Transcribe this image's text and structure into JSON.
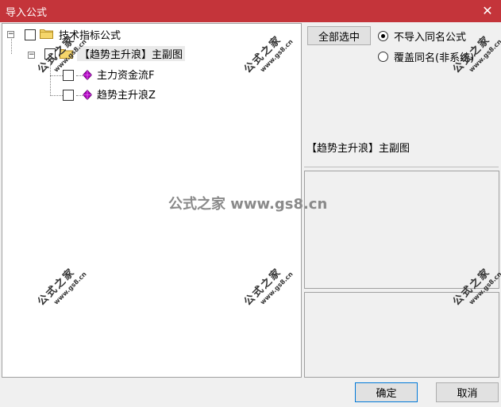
{
  "window": {
    "title": "导入公式",
    "close_glyph": "✕"
  },
  "tree": {
    "root": {
      "label": "技术指标公式",
      "expander": "−"
    },
    "group": {
      "label": "【趋势主升浪】主副图",
      "expander": "−"
    },
    "items": [
      {
        "label": "主力资金流F"
      },
      {
        "label": "趋势主升浪Z"
      }
    ]
  },
  "actions": {
    "select_all": "全部选中",
    "ok": "确定",
    "cancel": "取消"
  },
  "options": {
    "no_import_same": "不导入同名公式",
    "overwrite_same": "覆盖同名(非系统)",
    "selected": "no_import_same"
  },
  "info": {
    "formula_name": "【趋势主升浪】主副图"
  },
  "watermark": {
    "center": "公式之家 www.gs8.cn",
    "stamp_big": "公式之家",
    "stamp_small": "www.gs8.cn"
  },
  "colors": {
    "titlebar": "#c4343a",
    "gem": "#b000c0"
  }
}
